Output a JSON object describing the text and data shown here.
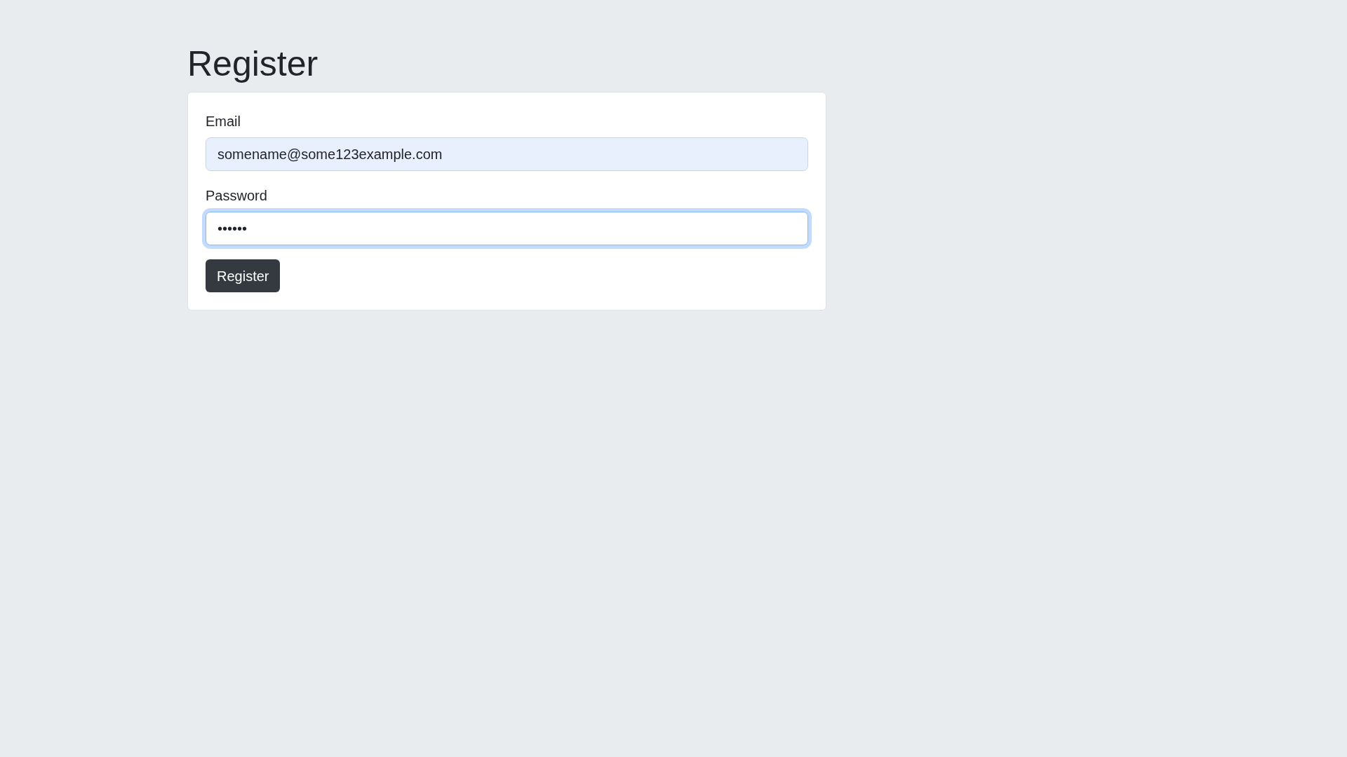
{
  "page": {
    "title": "Register"
  },
  "form": {
    "fields": [
      {
        "label": "Email",
        "value": "somename@some123example.com",
        "autofilled": true,
        "focused": false
      },
      {
        "label": "Password",
        "value": "••••••",
        "autofilled": false,
        "focused": true
      }
    ],
    "submit_button": "Register"
  }
}
